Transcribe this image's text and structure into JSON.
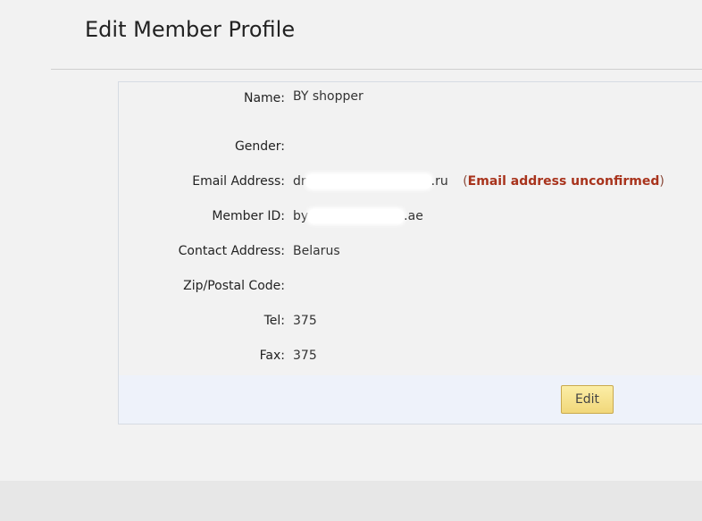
{
  "page": {
    "title": "Edit Member Profile"
  },
  "profile": {
    "fields": [
      {
        "label": "Name:",
        "value": "BY  shopper"
      },
      {
        "label": "Gender:",
        "value": ""
      },
      {
        "label": "Email Address:",
        "value_prefix": "dr",
        "value_suffix": ".ru",
        "status_open": "(",
        "status_text": "Email address unconfirmed",
        "status_close": ")"
      },
      {
        "label": "Member ID:",
        "value_prefix": "by",
        "value_suffix": ".ae"
      },
      {
        "label": "Contact Address:",
        "value": "Belarus"
      },
      {
        "label": "Zip/Postal Code:",
        "value": ""
      },
      {
        "label": "Tel:",
        "value": "375"
      },
      {
        "label": "Fax:",
        "value": "375"
      }
    ]
  },
  "actions": {
    "edit_label": "Edit"
  },
  "colors": {
    "unconfirmed_text": "#a8331c",
    "button_border": "#c9a94d",
    "button_fill": "#f1d77a"
  }
}
